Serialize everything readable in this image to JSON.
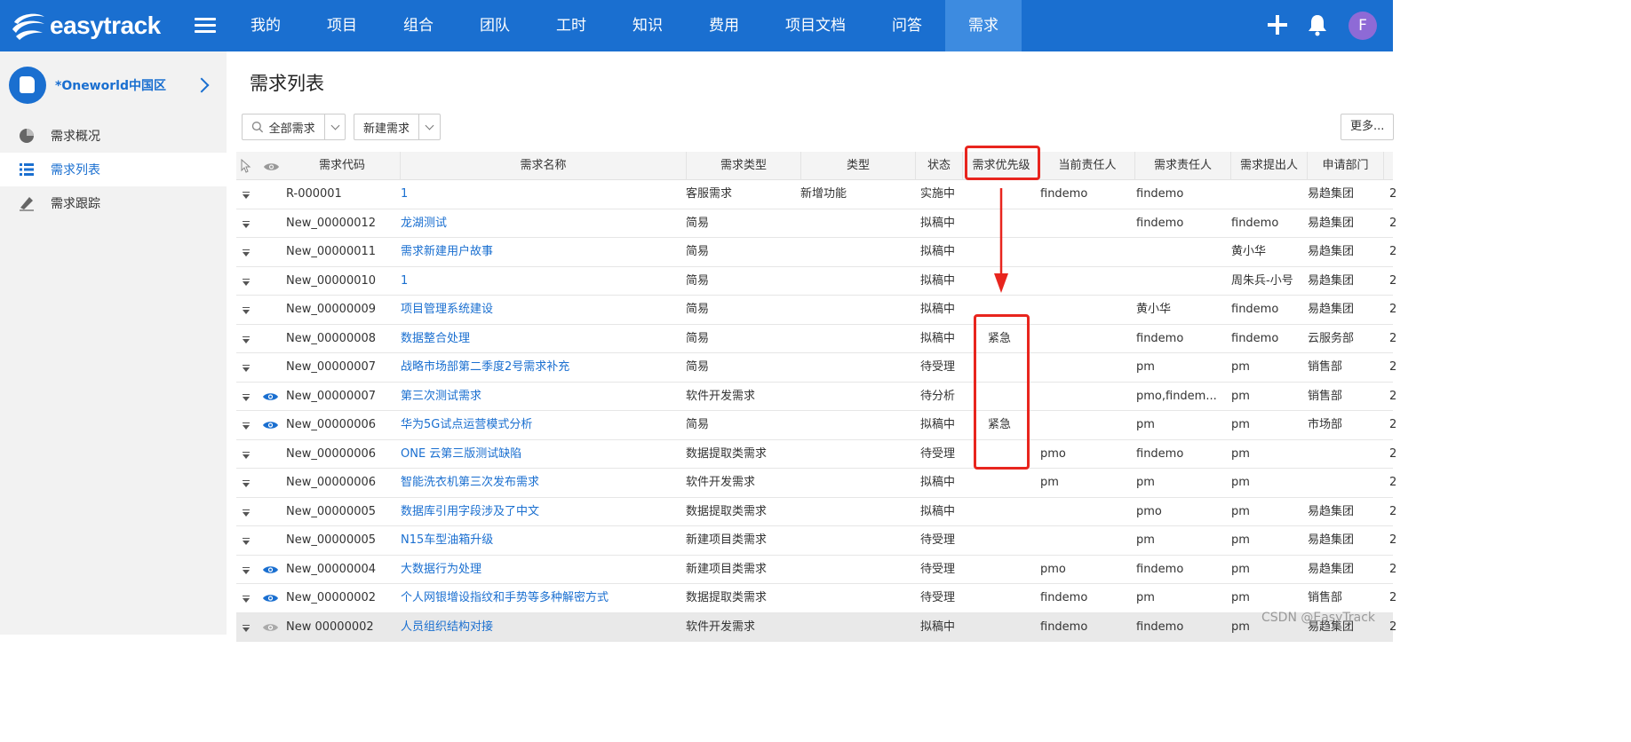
{
  "brand": {
    "name": "easytrack"
  },
  "nav": {
    "items": [
      "我的",
      "项目",
      "组合",
      "团队",
      "工时",
      "知识",
      "费用",
      "项目文档",
      "问答",
      "需求"
    ],
    "active_index": 9
  },
  "user": {
    "avatar_letter": "F"
  },
  "sidebar": {
    "project_name": "*Oneworld中国区",
    "items": [
      {
        "label": "需求概况",
        "icon": "pie-chart-icon"
      },
      {
        "label": "需求列表",
        "icon": "list-icon",
        "active": true
      },
      {
        "label": "需求跟踪",
        "icon": "pen-icon"
      }
    ]
  },
  "page": {
    "title": "需求列表",
    "filter_label": "全部需求",
    "new_label": "新建需求",
    "more_label": "更多..."
  },
  "table": {
    "columns": [
      "需求代码",
      "需求名称",
      "需求类型",
      "类型",
      "状态",
      "需求优先级",
      "当前责任人",
      "需求责任人",
      "需求提出人",
      "申请部门"
    ],
    "rows": [
      {
        "eye": false,
        "code": "R-000001",
        "name": "1",
        "req_type": "客服需求",
        "type": "新增功能",
        "status": "实施中",
        "priority": "",
        "current_owner": "findemo",
        "req_owner": "findemo",
        "proposer": "",
        "dept": "易趋集团",
        "tail": "2"
      },
      {
        "eye": false,
        "code": "New_00000012",
        "name": "龙湖测试",
        "req_type": "简易",
        "type": "",
        "status": "拟稿中",
        "priority": "",
        "current_owner": "",
        "req_owner": "findemo",
        "proposer": "findemo",
        "dept": "易趋集团",
        "tail": "2"
      },
      {
        "eye": false,
        "code": "New_00000011",
        "name": "需求新建用户故事",
        "req_type": "简易",
        "type": "",
        "status": "拟稿中",
        "priority": "",
        "current_owner": "",
        "req_owner": "",
        "proposer": "黄小华",
        "dept": "易趋集团",
        "tail": "2"
      },
      {
        "eye": false,
        "code": "New_00000010",
        "name": "1",
        "req_type": "简易",
        "type": "",
        "status": "拟稿中",
        "priority": "",
        "current_owner": "",
        "req_owner": "",
        "proposer": "周朱兵-小号",
        "dept": "易趋集团",
        "tail": "2"
      },
      {
        "eye": false,
        "code": "New_00000009",
        "name": "项目管理系统建设",
        "req_type": "简易",
        "type": "",
        "status": "拟稿中",
        "priority": "",
        "current_owner": "",
        "req_owner": "黄小华",
        "proposer": "findemo",
        "dept": "易趋集团",
        "tail": "2"
      },
      {
        "eye": false,
        "code": "New_00000008",
        "name": "数据整合处理",
        "req_type": "简易",
        "type": "",
        "status": "拟稿中",
        "priority": "紧急",
        "current_owner": "",
        "req_owner": "findemo",
        "proposer": "findemo",
        "dept": "云服务部",
        "tail": "2"
      },
      {
        "eye": false,
        "code": "New_00000007",
        "name": "战略市场部第二季度2号需求补充",
        "req_type": "简易",
        "type": "",
        "status": "待受理",
        "priority": "",
        "current_owner": "",
        "req_owner": "pm",
        "proposer": "pm",
        "dept": "销售部",
        "tail": "2"
      },
      {
        "eye": true,
        "code": "New_00000007",
        "name": "第三次测试需求",
        "req_type": "软件开发需求",
        "type": "",
        "status": "待分析",
        "priority": "",
        "current_owner": "",
        "req_owner": "pmo,findem...",
        "proposer": "pm",
        "dept": "销售部",
        "tail": "2"
      },
      {
        "eye": true,
        "code": "New_00000006",
        "name": "华为5G试点运营模式分析",
        "req_type": "简易",
        "type": "",
        "status": "拟稿中",
        "priority": "紧急",
        "current_owner": "",
        "req_owner": "pm",
        "proposer": "pm",
        "dept": "市场部",
        "tail": "2"
      },
      {
        "eye": false,
        "code": "New_00000006",
        "name": "ONE 云第三版测试缺陷",
        "req_type": "数据提取类需求",
        "type": "",
        "status": "待受理",
        "priority": "",
        "current_owner": "pmo",
        "req_owner": "findemo",
        "proposer": "pm",
        "dept": "",
        "tail": "2"
      },
      {
        "eye": false,
        "code": "New_00000006",
        "name": "智能洗衣机第三次发布需求",
        "req_type": "软件开发需求",
        "type": "",
        "status": "拟稿中",
        "priority": "",
        "current_owner": "pm",
        "req_owner": "pm",
        "proposer": "pm",
        "dept": "",
        "tail": "2"
      },
      {
        "eye": false,
        "code": "New_00000005",
        "name": "数据库引用字段涉及了中文",
        "req_type": "数据提取类需求",
        "type": "",
        "status": "拟稿中",
        "priority": "",
        "current_owner": "",
        "req_owner": "pmo",
        "proposer": "pm",
        "dept": "易趋集团",
        "tail": "2"
      },
      {
        "eye": false,
        "code": "New_00000005",
        "name": "N15车型油箱升级",
        "req_type": "新建项目类需求",
        "type": "",
        "status": "待受理",
        "priority": "",
        "current_owner": "",
        "req_owner": "pm",
        "proposer": "pm",
        "dept": "易趋集团",
        "tail": "2"
      },
      {
        "eye": true,
        "code": "New_00000004",
        "name": "大数据行为处理",
        "req_type": "新建项目类需求",
        "type": "",
        "status": "待受理",
        "priority": "",
        "current_owner": "pmo",
        "req_owner": "findemo",
        "proposer": "pm",
        "dept": "易趋集团",
        "tail": "2"
      },
      {
        "eye": true,
        "code": "New_00000002",
        "name": "个人网银增设指纹和手势等多种解密方式",
        "req_type": "数据提取类需求",
        "type": "",
        "status": "待受理",
        "priority": "",
        "current_owner": "findemo",
        "req_owner": "pm",
        "proposer": "pm",
        "dept": "销售部",
        "tail": "2"
      },
      {
        "eye": true,
        "code": "New 00000002",
        "name": "人员组织结构对接",
        "req_type": "软件开发需求",
        "type": "",
        "status": "拟稿中",
        "priority": "",
        "current_owner": "findemo",
        "req_owner": "findemo",
        "proposer": "pm",
        "dept": "易趋集团",
        "tail": "2"
      }
    ]
  },
  "watermark": "CSDN @EasyTrack",
  "colors": {
    "brand_blue": "#1a6fd0",
    "nav_active": "#3d8be0",
    "annotation_red": "#e8251e",
    "avatar": "#8e6ad6"
  }
}
